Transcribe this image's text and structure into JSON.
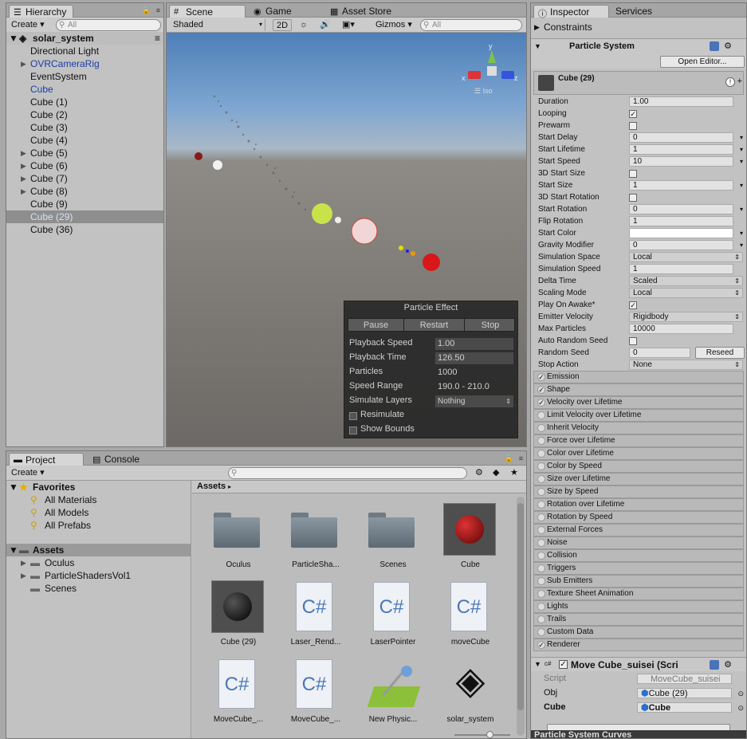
{
  "hierarchy": {
    "tab": "Hierarchy",
    "create": "Create",
    "search": "All",
    "scene": "solar_system",
    "items": [
      {
        "label": "Directional Light",
        "arrow": "",
        "cls": ""
      },
      {
        "label": "OVRCameraRig",
        "arrow": "▶",
        "cls": "blue"
      },
      {
        "label": "EventSystem",
        "arrow": "",
        "cls": ""
      },
      {
        "label": "Cube",
        "arrow": "",
        "cls": "blue"
      },
      {
        "label": "Cube (1)",
        "arrow": "",
        "cls": ""
      },
      {
        "label": "Cube (2)",
        "arrow": "",
        "cls": ""
      },
      {
        "label": "Cube (3)",
        "arrow": "",
        "cls": ""
      },
      {
        "label": "Cube (4)",
        "arrow": "",
        "cls": ""
      },
      {
        "label": "Cube (5)",
        "arrow": "▶",
        "cls": ""
      },
      {
        "label": "Cube (6)",
        "arrow": "▶",
        "cls": ""
      },
      {
        "label": "Cube (7)",
        "arrow": "▶",
        "cls": ""
      },
      {
        "label": "Cube (8)",
        "arrow": "▶",
        "cls": ""
      },
      {
        "label": "Cube (9)",
        "arrow": "",
        "cls": ""
      },
      {
        "label": "Cube (29)",
        "arrow": "",
        "cls": "sel"
      },
      {
        "label": "Cube (36)",
        "arrow": "",
        "cls": ""
      }
    ]
  },
  "scene": {
    "tabs": [
      "Scene",
      "Game",
      "Asset Store"
    ],
    "shading": "Shaded",
    "mode2d": "2D",
    "gizmos": "Gizmos",
    "search": "All",
    "persp": "Iso",
    "axes": {
      "x": "x",
      "y": "y",
      "z": "z"
    }
  },
  "particle_effect": {
    "title": "Particle Effect",
    "pause": "Pause",
    "restart": "Restart",
    "stop": "Stop",
    "playback_speed_label": "Playback Speed",
    "playback_speed": "1.00",
    "playback_time_label": "Playback Time",
    "playback_time": "126.50",
    "particles_label": "Particles",
    "particles": "1000",
    "speed_range_label": "Speed Range",
    "speed_range": "190.0 - 210.0",
    "simulate_layers_label": "Simulate Layers",
    "simulate_layers": "Nothing",
    "resimulate": "Resimulate",
    "show_bounds": "Show Bounds"
  },
  "project": {
    "tabs": [
      "Project",
      "Console"
    ],
    "create": "Create",
    "favorites": "Favorites",
    "fav_items": [
      "All Materials",
      "All Models",
      "All Prefabs"
    ],
    "assets_root": "Assets",
    "folders": [
      "Oculus",
      "ParticleShadersVol1",
      "Scenes"
    ],
    "breadcrumb": "Assets",
    "grid": [
      {
        "name": "Oculus",
        "kind": "folder"
      },
      {
        "name": "ParticleSha...",
        "kind": "folder"
      },
      {
        "name": "Scenes",
        "kind": "folder"
      },
      {
        "name": "Cube",
        "kind": "red-sphere"
      },
      {
        "name": "Cube (29)",
        "kind": "black-sphere"
      },
      {
        "name": "Laser_Rend...",
        "kind": "cs"
      },
      {
        "name": "LaserPointer",
        "kind": "cs"
      },
      {
        "name": "moveCube",
        "kind": "cs"
      },
      {
        "name": "MoveCube_...",
        "kind": "cs"
      },
      {
        "name": "MoveCube_...",
        "kind": "cs"
      },
      {
        "name": "New Physic...",
        "kind": "physic"
      },
      {
        "name": "solar_system",
        "kind": "unity"
      }
    ]
  },
  "inspector": {
    "tabs": [
      "Inspector",
      "Services"
    ],
    "constraints": "Constraints",
    "component": "Particle System",
    "open_editor": "Open Editor...",
    "system_name": "Cube (29)",
    "props": [
      {
        "label": "Duration",
        "type": "text",
        "value": "1.00",
        "dd": false
      },
      {
        "label": "Looping",
        "type": "check",
        "value": "✓"
      },
      {
        "label": "Prewarm",
        "type": "check",
        "value": ""
      },
      {
        "label": "Start Delay",
        "type": "text",
        "value": "0",
        "dd": true
      },
      {
        "label": "Start Lifetime",
        "type": "text",
        "value": "1",
        "dd": true
      },
      {
        "label": "Start Speed",
        "type": "text",
        "value": "10",
        "dd": true
      },
      {
        "label": "3D Start Size",
        "type": "check",
        "value": ""
      },
      {
        "label": "Start Size",
        "type": "text",
        "value": "1",
        "dd": true
      },
      {
        "label": "3D Start Rotation",
        "type": "check",
        "value": ""
      },
      {
        "label": "Start Rotation",
        "type": "text",
        "value": "0",
        "dd": true
      },
      {
        "label": "Flip Rotation",
        "type": "text",
        "value": "1",
        "dd": false
      },
      {
        "label": "Start Color",
        "type": "color",
        "value": ""
      },
      {
        "label": "Gravity Modifier",
        "type": "text",
        "value": "0",
        "dd": true
      },
      {
        "label": "Simulation Space",
        "type": "select",
        "value": "Local"
      },
      {
        "label": "Simulation Speed",
        "type": "text",
        "value": "1",
        "dd": false
      },
      {
        "label": "Delta Time",
        "type": "select",
        "value": "Scaled"
      },
      {
        "label": "Scaling Mode",
        "type": "select",
        "value": "Local"
      },
      {
        "label": "Play On Awake*",
        "type": "check",
        "value": "✓"
      },
      {
        "label": "Emitter Velocity",
        "type": "select",
        "value": "Rigidbody"
      },
      {
        "label": "Max Particles",
        "type": "text",
        "value": "10000",
        "dd": false
      },
      {
        "label": "Auto Random Seed",
        "type": "check",
        "value": ""
      },
      {
        "label": "Random Seed",
        "type": "seed",
        "value": "0"
      },
      {
        "label": "Stop Action",
        "type": "select",
        "value": "None"
      }
    ],
    "reseed": "Reseed",
    "modules": [
      {
        "label": "Emission",
        "on": "✓"
      },
      {
        "label": "Shape",
        "on": "✓"
      },
      {
        "label": "Velocity over Lifetime",
        "on": "✓"
      },
      {
        "label": "Limit Velocity over Lifetime",
        "on": ""
      },
      {
        "label": "Inherit Velocity",
        "on": ""
      },
      {
        "label": "Force over Lifetime",
        "on": ""
      },
      {
        "label": "Color over Lifetime",
        "on": ""
      },
      {
        "label": "Color by Speed",
        "on": ""
      },
      {
        "label": "Size over Lifetime",
        "on": ""
      },
      {
        "label": "Size by Speed",
        "on": ""
      },
      {
        "label": "Rotation over Lifetime",
        "on": ""
      },
      {
        "label": "Rotation by Speed",
        "on": ""
      },
      {
        "label": "External Forces",
        "on": ""
      },
      {
        "label": "Noise",
        "on": ""
      },
      {
        "label": "Collision",
        "on": ""
      },
      {
        "label": "Triggers",
        "on": ""
      },
      {
        "label": "Sub Emitters",
        "on": ""
      },
      {
        "label": "Texture Sheet Animation",
        "on": ""
      },
      {
        "label": "Lights",
        "on": ""
      },
      {
        "label": "Trails",
        "on": ""
      },
      {
        "label": "Custom Data",
        "on": ""
      },
      {
        "label": "Renderer",
        "on": "✓"
      }
    ],
    "script_component": "Move Cube_suisei (Scri",
    "script_label": "Script",
    "script_value": "MoveCube_suisei",
    "obj_label": "Obj",
    "obj_value": "Cube (29)",
    "cube_label": "Cube",
    "cube_value": "Cube",
    "curves": "Particle System Curves"
  }
}
